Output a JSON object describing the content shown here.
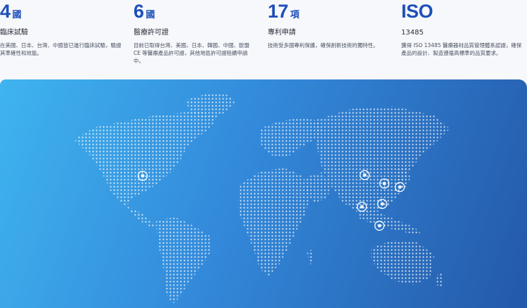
{
  "stats": [
    {
      "number": "4",
      "unit": "國",
      "title": "臨床試驗",
      "desc": "在美國、日本、台灣、中國皆已進行臨床試驗，驗證其準確性和效能。"
    },
    {
      "number": "6",
      "unit": "國",
      "title": "醫療許可證",
      "desc": "目前已取得台灣、美國、日本、韓國、中國、歐盟 CE 等醫療產品許可證，其他地區許可證陸續申請中。"
    },
    {
      "number": "17",
      "unit": "項",
      "title": "專利申請",
      "desc": "技術受多國專利保護，確保創新技術的獨特性。"
    },
    {
      "number": "ISO",
      "unit": "",
      "title": "13485",
      "desc": "獲得 ISO 13485 醫療器材品質管理體系認證，確保產品的設計、製造遵循高標準的品質要求。"
    }
  ],
  "map": {
    "gradient_start": "#3fb4ef",
    "gradient_end": "#2458a8",
    "marker_icon": "location-marker-icon",
    "marker_count": 7
  }
}
